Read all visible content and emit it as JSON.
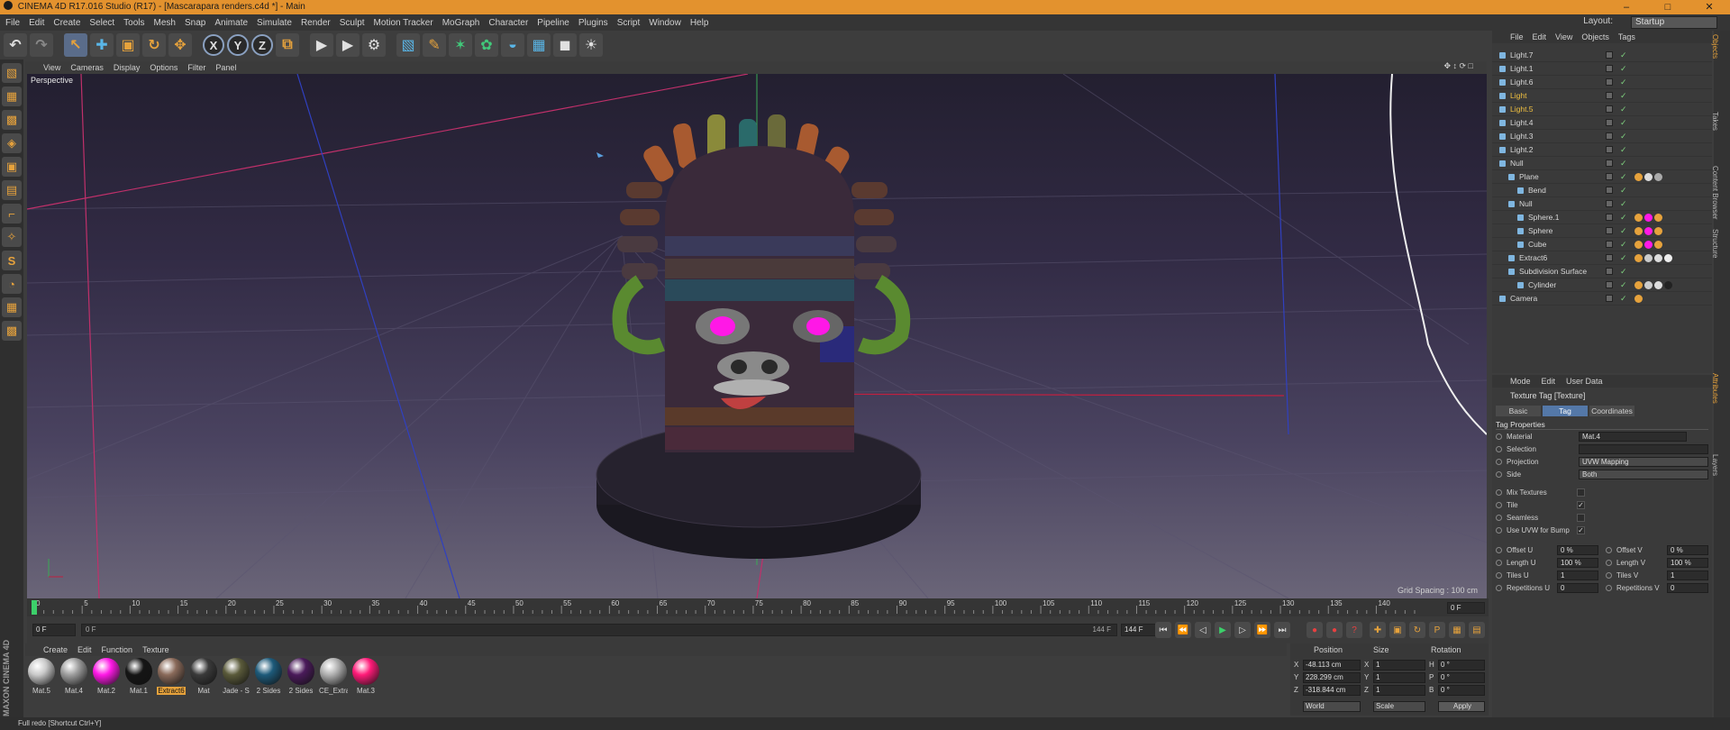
{
  "window": {
    "title": "CINEMA 4D R17.016 Studio (R17) - [Mascarapara renders.c4d *] - Main",
    "controls": [
      "–",
      "□",
      "✕"
    ]
  },
  "menubar": [
    "File",
    "Edit",
    "Create",
    "Select",
    "Tools",
    "Mesh",
    "Snap",
    "Animate",
    "Simulate",
    "Render",
    "Sculpt",
    "Motion Tracker",
    "MoGraph",
    "Character",
    "Pipeline",
    "Plugins",
    "Script",
    "Window",
    "Help"
  ],
  "layout": {
    "label": "Layout:",
    "value": "Startup"
  },
  "toolbar": {
    "undo": "↶",
    "redo": "↷",
    "select": "↖",
    "move": "✚",
    "scale": "▣",
    "rotate": "↻",
    "transform": "✥",
    "x_axis": "X",
    "y_axis": "Y",
    "z_axis": "Z",
    "world": "⧉",
    "render_view": "▶",
    "render_pic": "▶",
    "render_settings": "⚙",
    "cube": "▧",
    "pen": "✎",
    "subdivision": "✶",
    "array": "✿",
    "deformer": "◒",
    "floor": "▦",
    "camera": "◼",
    "light": "☀"
  },
  "left_tools": [
    "▧",
    "▦",
    "▩",
    "◈",
    "▣",
    "▤",
    "⌐",
    "✧",
    "S",
    "◔",
    "▦",
    "▩"
  ],
  "viewport": {
    "menu": [
      "View",
      "Cameras",
      "Display",
      "Options",
      "Filter",
      "Panel"
    ],
    "nav_icons": "✥ ↕ ⟳ □",
    "label": "Perspective",
    "grid_spacing": "Grid Spacing : 100 cm"
  },
  "timeline": {
    "ticks": [
      "0",
      "5",
      "10",
      "15",
      "20",
      "25",
      "30",
      "35",
      "40",
      "45",
      "50",
      "55",
      "60",
      "65",
      "70",
      "75",
      "80",
      "85",
      "90",
      "95",
      "100",
      "105",
      "110",
      "115",
      "120",
      "125",
      "130",
      "135",
      "140"
    ],
    "end_frame": "0 F",
    "playhead": 0,
    "end": 144
  },
  "playbar": {
    "current_frame": "0 F",
    "range_start": "0 F",
    "range_end_label": "144 F",
    "max_frame": "144 F",
    "transport": [
      "⏮",
      "⏪",
      "◁",
      "▶",
      "▷",
      "⏩",
      "⏭"
    ],
    "record": [
      "●",
      "●",
      "?"
    ],
    "keys": [
      "✚",
      "▣",
      "↻",
      "P",
      "▦",
      "▤"
    ]
  },
  "materials": {
    "menu": [
      "Create",
      "Edit",
      "Function",
      "Texture"
    ],
    "items": [
      {
        "name": "Mat.5",
        "color": "#c9c9c9",
        "active": false
      },
      {
        "name": "Mat.4",
        "color": "#9e9e9e",
        "active": false
      },
      {
        "name": "Mat.2",
        "color": "#ff18e6",
        "active": false
      },
      {
        "name": "Mat.1",
        "color": "#151515",
        "active": false
      },
      {
        "name": "Extract6",
        "color": "#8a6a5a",
        "active": true
      },
      {
        "name": "Mat",
        "color": "#3a3a3a",
        "active": false
      },
      {
        "name": "Jade - S",
        "color": "#5a5a3a",
        "active": false
      },
      {
        "name": "2 Sides",
        "color": "#1d5a7a",
        "active": false
      },
      {
        "name": "2 Sides",
        "color": "#4a1a5a",
        "active": false
      },
      {
        "name": "CE_Extra",
        "color": "#b0b0b0",
        "active": false
      },
      {
        "name": "Mat.3",
        "color": "#ff1a78",
        "active": false
      }
    ]
  },
  "maxon_logo": "MAXON CINEMA 4D",
  "coordinates": {
    "headers": [
      "Position",
      "Size",
      "Rotation"
    ],
    "rows": [
      {
        "axis": "X",
        "pos": "-48.113 cm",
        "size": "1",
        "rot_label": "H",
        "rot": "0 °"
      },
      {
        "axis": "Y",
        "pos": "228.299 cm",
        "size": "1",
        "rot_label": "P",
        "rot": "0 °"
      },
      {
        "axis": "Z",
        "pos": "-318.844 cm",
        "size": "1",
        "rot_label": "B",
        "rot": "0 °"
      }
    ],
    "mode1": "World",
    "mode2": "Scale",
    "apply": "Apply"
  },
  "status": "Full redo [Shortcut Ctrl+Y]",
  "objects": {
    "menu": [
      "File",
      "Edit",
      "View",
      "Objects",
      "Tags"
    ],
    "items": [
      {
        "name": "Light.7",
        "indent": 0,
        "highlight": false,
        "tags": []
      },
      {
        "name": "Light.1",
        "indent": 0,
        "highlight": false,
        "tags": []
      },
      {
        "name": "Light.6",
        "indent": 0,
        "highlight": false,
        "tags": []
      },
      {
        "name": "Light",
        "indent": 0,
        "highlight": true,
        "tags": []
      },
      {
        "name": "Light.5",
        "indent": 0,
        "highlight": true,
        "tags": []
      },
      {
        "name": "Light.4",
        "indent": 0,
        "highlight": false,
        "tags": []
      },
      {
        "name": "Light.3",
        "indent": 0,
        "highlight": false,
        "tags": []
      },
      {
        "name": "Light.2",
        "indent": 0,
        "highlight": false,
        "tags": []
      },
      {
        "name": "Null",
        "indent": 0,
        "highlight": false,
        "tags": []
      },
      {
        "name": "Plane",
        "indent": 1,
        "highlight": false,
        "tags": [
          "#e6a23c",
          "#dddddd",
          "#aaaaaa"
        ]
      },
      {
        "name": "Bend",
        "indent": 2,
        "highlight": false,
        "tags": []
      },
      {
        "name": "Null",
        "indent": 1,
        "highlight": false,
        "tags": []
      },
      {
        "name": "Sphere.1",
        "indent": 2,
        "highlight": false,
        "tags": [
          "#e6a23c",
          "#ff18e6",
          "#e6a23c"
        ]
      },
      {
        "name": "Sphere",
        "indent": 2,
        "highlight": false,
        "tags": [
          "#e6a23c",
          "#ff18e6",
          "#e6a23c"
        ]
      },
      {
        "name": "Cube",
        "indent": 2,
        "highlight": false,
        "tags": [
          "#e6a23c",
          "#ff18e6",
          "#e6a23c"
        ]
      },
      {
        "name": "Extract6",
        "indent": 1,
        "highlight": false,
        "tags": [
          "#e6a23c",
          "#cccccc",
          "#dddddd",
          "#eeeeee"
        ]
      },
      {
        "name": "Subdivision Surface",
        "indent": 1,
        "highlight": false,
        "tags": []
      },
      {
        "name": "Cylinder",
        "indent": 2,
        "highlight": false,
        "tags": [
          "#e6a23c",
          "#cccccc",
          "#dddddd",
          "#222222"
        ]
      },
      {
        "name": "Camera",
        "indent": 0,
        "highlight": false,
        "tags": [
          "#e6a23c"
        ]
      }
    ]
  },
  "side_tabs": [
    "Objects",
    "Takes",
    "Content Browser",
    "Structure",
    "Attributes",
    "Layers"
  ],
  "attributes": {
    "menu": [
      "Mode",
      "Edit",
      "User Data"
    ],
    "title": "Texture Tag [Texture]",
    "tabs": [
      "Basic",
      "Tag",
      "Coordinates"
    ],
    "active_tab": "Tag",
    "section": "Tag Properties",
    "material_label": "Material",
    "material_value": "Mat.4",
    "selection_label": "Selection",
    "projection_label": "Projection",
    "projection_value": "UVW Mapping",
    "side_label": "Side",
    "side_value": "Both",
    "mix_label": "Mix Textures",
    "tile_label": "Tile",
    "seamless_label": "Seamless",
    "uvwbump_label": "Use UVW for Bump",
    "offset_u_label": "Offset U",
    "offset_u": "0 %",
    "offset_v_label": "Offset V",
    "offset_v": "0 %",
    "length_u_label": "Length U",
    "length_u": "100 %",
    "length_v_label": "Length V",
    "length_v": "100 %",
    "tiles_u_label": "Tiles U",
    "tiles_u": "1",
    "tiles_v_label": "Tiles V",
    "tiles_v": "1",
    "rep_u_label": "Repetitions U",
    "rep_u": "0",
    "rep_v_label": "Repetitions V",
    "rep_v": "0",
    "check": "✓"
  }
}
